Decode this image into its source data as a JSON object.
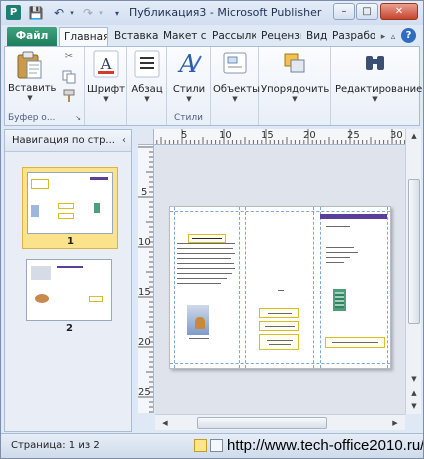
{
  "window": {
    "app_icon_letter": "P",
    "title": "Публикация3  -  Microsoft Publisher",
    "qat": {
      "save": "💾",
      "undo": "↶",
      "redo": "↷"
    },
    "controls": {
      "minimize": "–",
      "maximize": "□",
      "close": "✕"
    }
  },
  "tabs": [
    "Файл",
    "Главная",
    "Вставка",
    "Макет с",
    "Рассылк",
    "Рецензи",
    "Вид",
    "Разрабо"
  ],
  "active_tab": "Главная",
  "ribbon": {
    "paste_label": "Вставить",
    "clipboard_group": "Буфер о...",
    "font_label": "Шрифт",
    "paragraph_label": "Абзац",
    "styles_label": "Стили",
    "styles_group": "Стили",
    "objects_label": "Объекты",
    "arrange_label": "Упорядочить",
    "editing_label": "Редактирование"
  },
  "nav_pane": {
    "title": "Навигация по стр...",
    "collapse": "‹",
    "pages": [
      {
        "number": "1",
        "selected": true
      },
      {
        "number": "2",
        "selected": false
      }
    ]
  },
  "rulers": {
    "horizontal": [
      "5",
      "10",
      "15",
      "20",
      "25",
      "30"
    ],
    "vertical": [
      "5",
      "10",
      "15",
      "20",
      "25"
    ]
  },
  "status": {
    "page_info": "Страница: 1 из 2"
  },
  "watermark": "http://www.tech-office2010.ru/",
  "colors": {
    "file_tab": "#1c7c5a",
    "selection": "#fbe38e",
    "guides": "#7fa6d8",
    "textbox_border": "#d8bd28"
  }
}
